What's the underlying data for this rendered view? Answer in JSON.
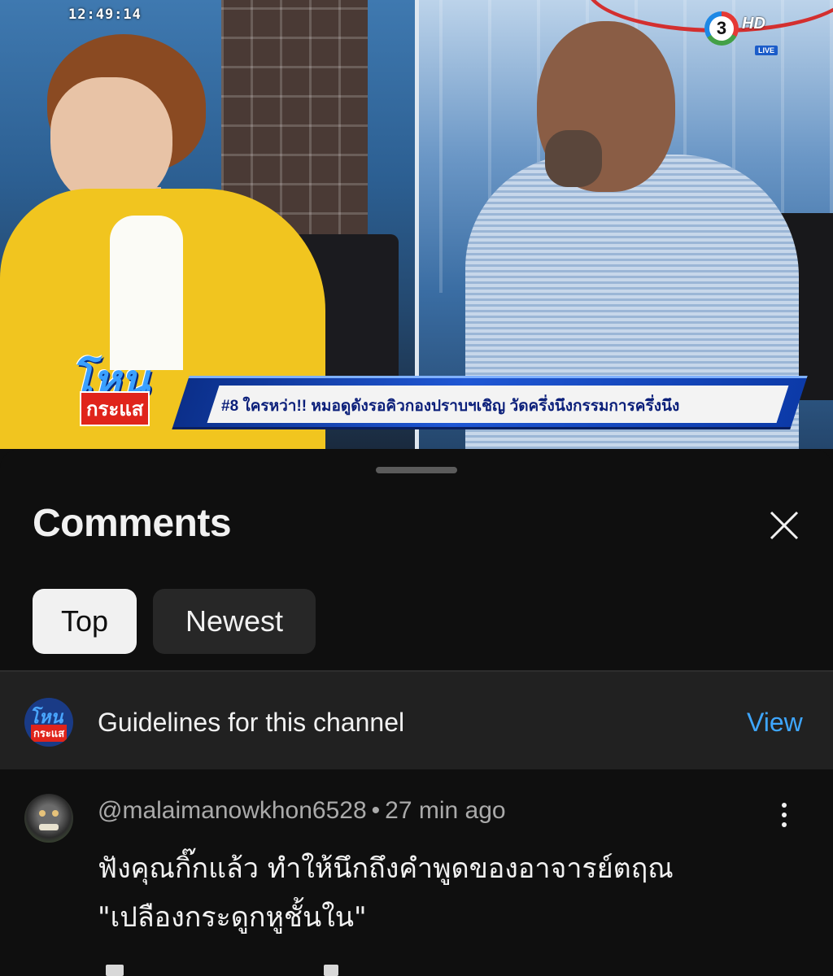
{
  "video": {
    "timestamp": "12:49:14",
    "channel_logo_text": "3",
    "hd_label": "HD",
    "live_label": "LIVE",
    "show_logo_line1": "โหน",
    "show_logo_line2": "กระแส",
    "lower_third": "#8 ใครหว่า!! หมอดูดังรอคิวกองปราบฯเชิญ วัดครึ่งนึงกรรมการครึ่งนึง"
  },
  "comments_sheet": {
    "title": "Comments",
    "close_icon": "close-icon",
    "sort_chips": [
      {
        "label": "Top",
        "selected": true
      },
      {
        "label": "Newest",
        "selected": false
      }
    ],
    "guidelines": {
      "avatar_line1": "โหน",
      "avatar_line2": "กระแส",
      "text": "Guidelines for this channel",
      "action": "View"
    },
    "comments": [
      {
        "author": "@malaimanowkhon6528",
        "separator": "•",
        "time": "27 min ago",
        "text_line1": "ฟังคุณกิ๊กแล้ว ทำให้นึกถึงคำพูดของอาจารย์ตฤณ",
        "text_line2": "\"เปลืองกระดูกหูชั้นใน\"",
        "more_icon": "more-vert-icon"
      }
    ]
  },
  "colors": {
    "sheet_bg": "#0f0f0f",
    "chip_selected_bg": "#f1f1f1",
    "chip_bg": "#272727",
    "link_blue": "#3ea6ff",
    "meta_gray": "#aaaaaa"
  }
}
